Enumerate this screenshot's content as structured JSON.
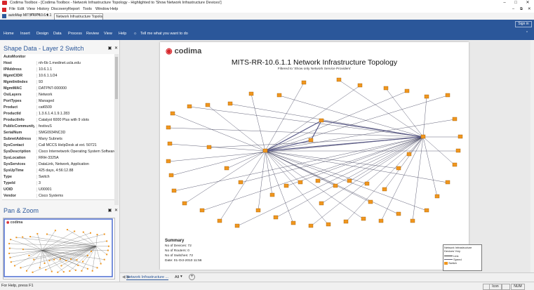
{
  "window": {
    "title": "Codima Toolbox - [Codima Toolbox - Network Infrastructure Topology - Highlighted to 'Show Network Infrastructure Devices']",
    "controls": [
      "minimize",
      "maximize",
      "close"
    ]
  },
  "menu": [
    "File",
    "Edit",
    "View",
    "History",
    "Discovery",
    "Report",
    "Tools",
    "Window",
    "Help"
  ],
  "qat": {
    "doc_label": "autoMap MITS-RR-10.6.1.1",
    "doc_tab": "Network Infrastructure Topology"
  },
  "ribbon": {
    "tabs": [
      "Home",
      "Insert",
      "Design",
      "Data",
      "Process",
      "Review",
      "View",
      "Help"
    ],
    "tell_me": "Tell me what you want to do",
    "sign_in": "Sign in"
  },
  "shape_data": {
    "title": "Shape Data - Layer 2 Switch",
    "rows": [
      {
        "k": "AutoMonitor",
        "v": ""
      },
      {
        "k": "Host",
        "v": "nh-6k-1.medinet.ucla.edu"
      },
      {
        "k": "IPAddress",
        "v": "10.6.1.1"
      },
      {
        "k": "MgmtCIDR",
        "v": "10.6.1.1/24"
      },
      {
        "k": "MgmtIntIndex",
        "v": "93"
      },
      {
        "k": "MgmtMAC",
        "v": "DATPNT-000000"
      },
      {
        "k": "OsiLayers",
        "v": "Network"
      },
      {
        "k": "PortTypes",
        "v": "Managed"
      },
      {
        "k": "Product",
        "v": "cat6509"
      },
      {
        "k": "ProductId",
        "v": "1.3.6.1.4.1.9.1.283"
      },
      {
        "k": "ProductInfo",
        "v": "Catalyst 6000 Plus with 9 slots"
      },
      {
        "k": "PublicCommunity",
        "v": "festivuS"
      },
      {
        "k": "SerialNum",
        "v": "SMG0934NC3D"
      },
      {
        "k": "SubnetAddress",
        "v": "Many Subnets"
      },
      {
        "k": "SysContact",
        "v": "Call MCCS HelpDesk at ext. 50721"
      },
      {
        "k": "SysDescription",
        "v": "Cisco Internetwork Operating System Software IOS ("
      },
      {
        "k": "SysLocation",
        "v": "RRH-3325A"
      },
      {
        "k": "SysServices",
        "v": "DataLink, Network, Application"
      },
      {
        "k": "SysUpTime",
        "v": "425 days, 4:56:12.88"
      },
      {
        "k": "Type",
        "v": "Switch"
      },
      {
        "k": "TypeId",
        "v": "3"
      },
      {
        "k": "UOID",
        "v": "U00001"
      },
      {
        "k": "Vendor",
        "v": "Cisco Systems"
      }
    ]
  },
  "pan_zoom": {
    "title": "Pan & Zoom"
  },
  "diagram": {
    "brand": "codima",
    "title": "MITS-RR-10.6.1.1 Network Infrastructure Topology",
    "subtitle": "Filtered to 'Show only Network Service Providers'",
    "summary": {
      "heading": "Summary",
      "lines": [
        "No of Devices: 72",
        "No of Routers: 0",
        "No of Switches: 72",
        "Date: 01-Oct-2010 11:56"
      ]
    },
    "legend": {
      "title": "Network Infrastructure Devices' Key",
      "items": [
        "Link",
        "Speed",
        "Switch"
      ]
    },
    "device_color": "#f0961e",
    "link_color": "#3a3a55"
  },
  "page_tabs": {
    "active": "Network Infrastructure ...",
    "all": "All",
    "add": "+"
  },
  "status": {
    "help": "For Help, press F1",
    "icon": "Icon",
    "num": "NUM"
  }
}
